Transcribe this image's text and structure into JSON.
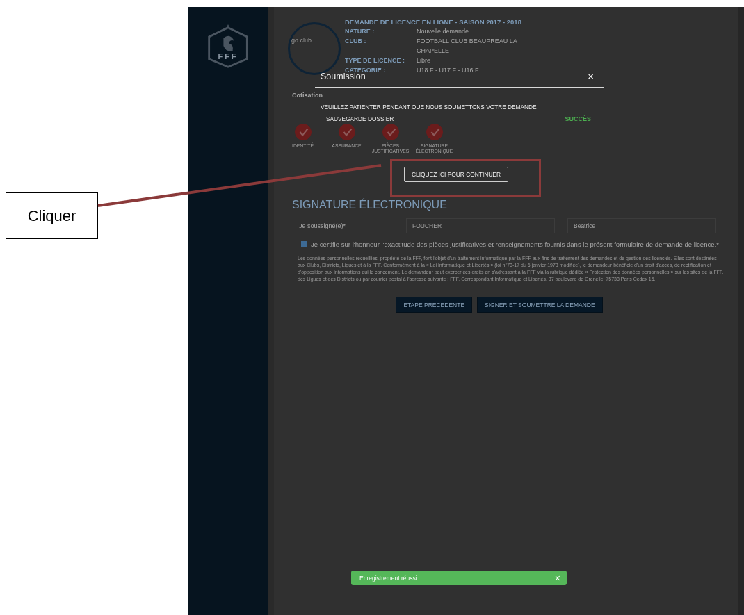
{
  "annotation": {
    "label": "Cliquer"
  },
  "sidebar": {
    "logo_text": "FFF"
  },
  "header": {
    "club_logo_text": "go club",
    "title": "DEMANDE DE LICENCE EN LIGNE - SAISON 2017 - 2018",
    "fields": [
      {
        "label": "NATURE :",
        "value": "Nouvelle demande"
      },
      {
        "label": "CLUB :",
        "value": "FOOTBALL CLUB BEAUPREAU LA CHAPELLE"
      },
      {
        "label": "TYPE DE LICENCE :",
        "value": "Libre"
      },
      {
        "label": "CATÉGORIE :",
        "value": "U18 F - U17 F - U16 F"
      }
    ]
  },
  "steps_title": "Cotisation",
  "steps": [
    {
      "label": "IDENTITÉ",
      "completed": true
    },
    {
      "label": "ASSURANCE",
      "completed": true
    },
    {
      "label": "PIÈCES JUSTIFICATIVES",
      "completed": true
    },
    {
      "label": "SIGNATURE ÉLECTRONIQUE",
      "completed": true
    }
  ],
  "signature": {
    "heading": "SIGNATURE ÉLECTRONIQUE",
    "label": "Je soussigné(e)*",
    "last_name": "FOUCHER",
    "first_name": "Beatrice",
    "certify": {
      "checked": true,
      "text": "Je certifie sur l'honneur l'exactitude des pièces justificatives et renseignements fournis dans le présent formulaire de demande de licence.*"
    },
    "legal_text": "Les données personnelles recueillies, propriété de la FFF, font l'objet d'un traitement informatique par la FFF aux fins de traitement des demandes et de gestion des licenciés. Elles sont destinées aux Clubs, Districts, Ligues et à la FFF. Conformément à la « Loi Informatique et Libertés » (loi n°78-17 du 6 janvier 1978 modifiée), le demandeur bénéficie d'un droit d'accès, de rectification et d'opposition aux informations qui le concernent. Le demandeur peut exercer ces droits en s'adressant à la FFF via la rubrique dédiée « Protection des données personnelles » sur les sites de la FFF, des Ligues et des Districts ou par courrier postal à l'adresse suivante : FFF, Correspondant Informatique et Libertés, 87 boulevard de Grenelle, 75738 Paris Cedex 15."
  },
  "buttons": [
    "ÉTAPE PRÉCÉDENTE",
    "SIGNER ET SOUMETTRE LA DEMANDE"
  ],
  "modal": {
    "title": "Soumission",
    "close": "×",
    "message": "VEUILLEZ PATIENTER PENDANT QUE NOUS SOUMETTONS VOTRE DEMANDE",
    "tasks": [
      {
        "label": "SAUVEGARDE DOSSIER",
        "status": "SUCCÈS",
        "color": "#4caf50"
      }
    ],
    "continue_button": "CLIQUEZ ICI POUR CONTINUER"
  },
  "toast": {
    "message": "Enregistrement réussi",
    "close": "×"
  }
}
